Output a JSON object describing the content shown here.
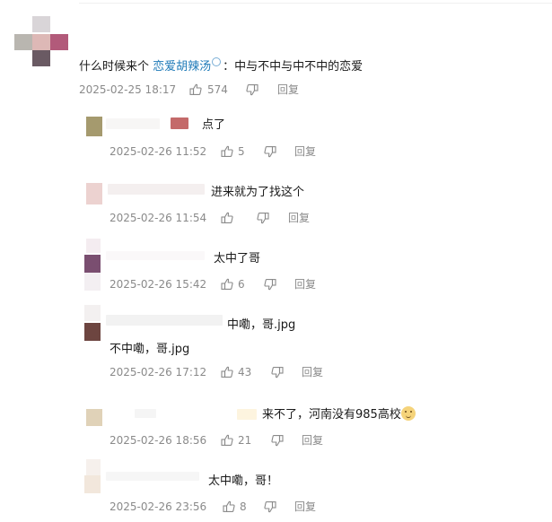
{
  "main_comment": {
    "text_before": "什么时候来个 ",
    "topic_link": "恋爱胡辣汤",
    "text_after": "：中与不中与中不中的恋爱",
    "time": "2025-02-25 18:17",
    "likes": "574",
    "reply_label": "回复"
  },
  "replies": [
    {
      "lines": [
        "点了"
      ],
      "time": "2025-02-26 11:52",
      "likes": "5",
      "reply_label": "回复"
    },
    {
      "lines": [
        "进来就为了找这个"
      ],
      "time": "2025-02-26 11:54",
      "likes": "",
      "reply_label": "回复"
    },
    {
      "lines": [
        "太中了哥"
      ],
      "time": "2025-02-26 15:42",
      "likes": "6",
      "reply_label": "回复"
    },
    {
      "lines": [
        "中嘞，哥.jpg",
        "不中嘞，哥.jpg"
      ],
      "time": "2025-02-26 17:12",
      "likes": "43",
      "reply_label": "回复"
    },
    {
      "lines": [
        "来不了，河南没有985高校"
      ],
      "time": "2025-02-26 18:56",
      "likes": "21",
      "reply_label": "回复"
    },
    {
      "lines": [
        "太中嘞，哥！"
      ],
      "time": "2025-02-26 23:56",
      "likes": "8",
      "reply_label": "回复"
    }
  ],
  "icons": {
    "like": "thumbs-up-icon",
    "dislike": "thumbs-down-icon",
    "topic": "search-icon",
    "emoji": "doge-emoji-icon"
  },
  "colors": {
    "topic_link": "#1f7ab8",
    "meta_text": "#8a8a8a"
  }
}
